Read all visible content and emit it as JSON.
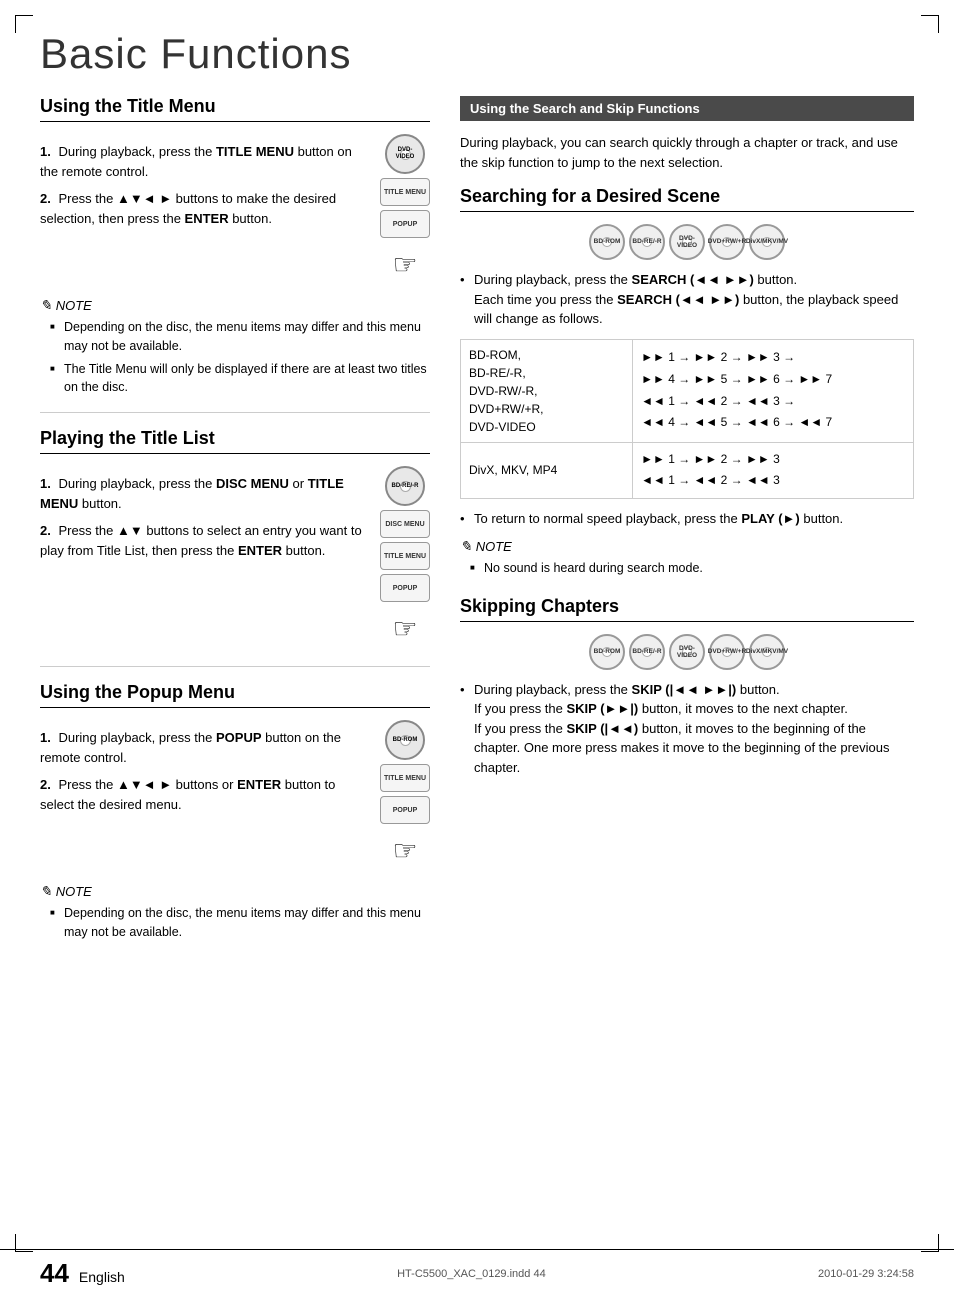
{
  "page": {
    "title": "Basic Functions",
    "page_number": "44",
    "language": "English",
    "footer_file": "HT-C5500_XAC_0129.indd   44",
    "footer_date": "2010-01-29   3:24:58"
  },
  "left": {
    "title_menu": {
      "heading": "Using the Title Menu",
      "steps": [
        {
          "num": "1.",
          "text_before": "During playback, press the ",
          "bold": "TITLE MENU",
          "text_after": " button on the remote control."
        },
        {
          "num": "2.",
          "text_before": "Press the ▲▼◄ ► buttons to make the desired selection, then press the ",
          "bold": "ENTER",
          "text_after": " button."
        }
      ],
      "note_title": "NOTE",
      "notes": [
        "Depending on the disc, the menu items may differ and this menu may not be available.",
        "The Title Menu will only be displayed if there are at least two titles on the disc."
      ],
      "remote_disc_label": "DVD-VIDEO",
      "remote_btn1": "TITLE MENU",
      "remote_btn2": "POPUP"
    },
    "title_list": {
      "heading": "Playing the Title List",
      "steps": [
        {
          "num": "1.",
          "text_before": "During playback, press the ",
          "bold": "DISC MENU",
          "text_after": " or ",
          "bold2": "TITLE MENU",
          "text_after2": " button."
        },
        {
          "num": "2.",
          "text_before": "Press the ▲▼ buttons to select an entry you want to play from Title List, then press the ",
          "bold": "ENTER",
          "text_after": " button."
        }
      ],
      "remote_disc_label": "BD-RE/-R",
      "remote_btn1": "DISC MENU",
      "remote_btn2": "TITLE MENU",
      "remote_btn3": "POPUP"
    },
    "popup_menu": {
      "heading": "Using the Popup Menu",
      "steps": [
        {
          "num": "1.",
          "text_before": "During playback, press the ",
          "bold": "POPUP",
          "text_after": " button on the remote control."
        },
        {
          "num": "2.",
          "text_before": "Press the ▲▼◄ ► buttons or ",
          "bold": "ENTER",
          "text_after": " button to select the desired menu."
        }
      ],
      "note_title": "NOTE",
      "notes": [
        "Depending on the disc, the menu items may differ and this menu may not be available."
      ],
      "remote_disc_label": "BD-ROM",
      "remote_btn1": "TITLE MENU",
      "remote_btn2": "POPUP"
    }
  },
  "right": {
    "highlight_bar": "Using the Search and Skip Functions",
    "intro": "During playback, you can search quickly through a chapter or track, and use the skip function to jump to the next selection.",
    "search_section": {
      "heading": "Searching for a Desired Scene",
      "discs": [
        "BD-ROM",
        "BD-RE/-R",
        "DVD-VIDEO",
        "DVD+RW/+R",
        "DivX/MKV/MV"
      ],
      "bullet1_before": "During playback, press the ",
      "bullet1_bold": "SEARCH (◄◄ ►►)",
      "bullet1_after": " button.\nEach time you press the ",
      "bullet1_bold2": "SEARCH (◄◄ ►►)",
      "bullet1_after2": " button, the playback speed will change as follows.",
      "table": {
        "rows": [
          {
            "disc": "BD-ROM,\nBD-RE/-R,\nDVD-RW/-R,\nDVD+RW/+R,\nDVD-VIDEO",
            "speeds": "►► 1 → ►► 2 → ►► 3 →\n►► 4 → ►► 5 → ►► 6 → ►► 7\n◄◄ 1 → ◄◄ 2 → ◄◄ 3 →\n◄◄ 4 → ◄◄ 5 → ◄◄ 6 → ◄◄ 7"
          },
          {
            "disc": "DivX, MKV, MP4",
            "speeds": "►► 1 → ►► 2 → ►► 3\n◄◄ 1 → ◄◄ 2 → ◄◄ 3"
          }
        ]
      },
      "return_text_before": "To return to normal speed playback, press the ",
      "return_bold": "PLAY (►)",
      "return_after": " button.",
      "note_title": "NOTE",
      "notes": [
        "No sound is heard during search mode."
      ]
    },
    "skip_section": {
      "heading": "Skipping Chapters",
      "discs": [
        "BD-ROM",
        "BD-RE/-R",
        "DVD-VIDEO",
        "DVD+RW/+R",
        "DivX/MKV/MV"
      ],
      "bullet1_before": "During playback, press the ",
      "bullet1_bold": "SKIP (|◄◄ ►►|)",
      "bullet1_after": " button.",
      "para2_before": "If you press the ",
      "para2_bold": "SKIP (►►|)",
      "para2_after": " button, it moves to the next chapter.",
      "para3_before": "If you press the ",
      "para3_bold": "SKIP (|◄◄)",
      "para3_after": " button, it moves to the beginning of the chapter. One more press makes it move to the beginning of the previous chapter."
    }
  }
}
